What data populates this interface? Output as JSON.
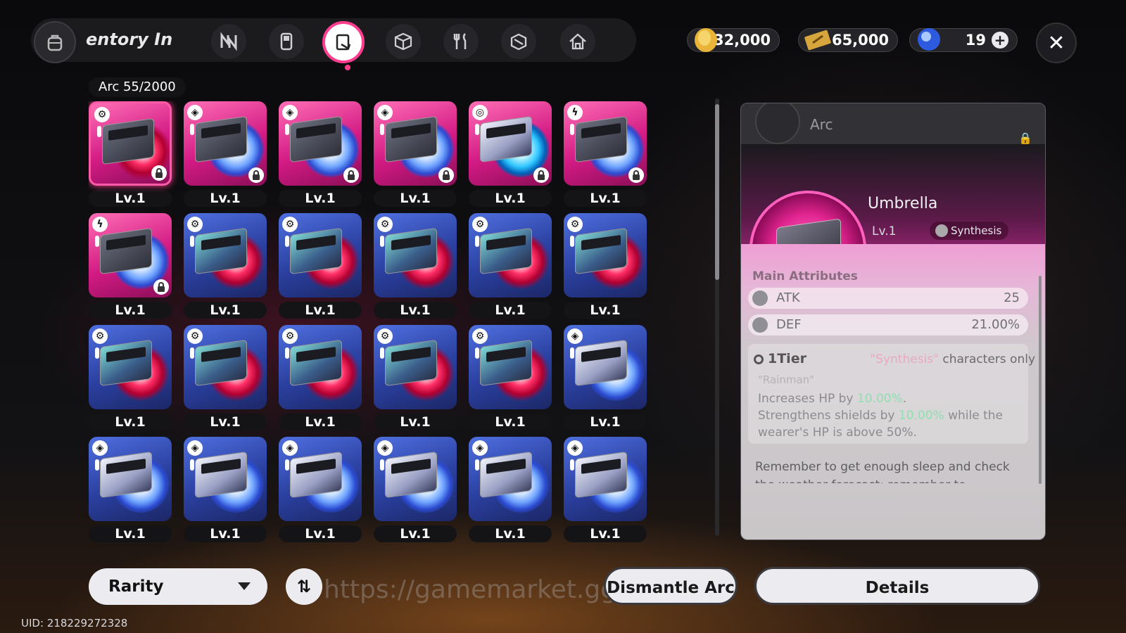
{
  "header": {
    "title": "entory  In",
    "categories": [
      "n-logo-icon",
      "console-icon",
      "arc-disc-icon",
      "cube-icon",
      "utensils-icon",
      "box-icon",
      "home-icon"
    ],
    "active_category": "arc-disc-icon",
    "accent": "#ff3d8e"
  },
  "currency": {
    "gold": "232,000",
    "tickets": "65,000",
    "gems": "19"
  },
  "inventory": {
    "label": "Arc",
    "count": "55/2000",
    "items": [
      {
        "level": "Lv.1",
        "rarity": "pink",
        "tag": "gear",
        "art": "red",
        "box": "dark",
        "locked": true,
        "selected": true
      },
      {
        "level": "Lv.1",
        "rarity": "pink",
        "tag": "cube",
        "art": "ice",
        "box": "dark",
        "locked": true
      },
      {
        "level": "Lv.1",
        "rarity": "pink",
        "tag": "cube",
        "art": "ice",
        "box": "dark",
        "locked": true
      },
      {
        "level": "Lv.1",
        "rarity": "pink",
        "tag": "cube",
        "art": "ice",
        "box": "dark",
        "locked": true
      },
      {
        "level": "Lv.1",
        "rarity": "pink",
        "tag": "swirl",
        "art": "cyan",
        "box": "white",
        "locked": true
      },
      {
        "level": "Lv.1",
        "rarity": "pink",
        "tag": "bolt",
        "art": "ice",
        "box": "dark",
        "locked": true
      },
      {
        "level": "Lv.1",
        "rarity": "pink",
        "tag": "bolt",
        "art": "ice",
        "box": "dark",
        "locked": true
      },
      {
        "level": "Lv.1",
        "rarity": "blue",
        "tag": "gear",
        "art": "red",
        "box": "hologram",
        "locked": false
      },
      {
        "level": "Lv.1",
        "rarity": "blue",
        "tag": "gear",
        "art": "red",
        "box": "hologram",
        "locked": false
      },
      {
        "level": "Lv.1",
        "rarity": "blue",
        "tag": "gear",
        "art": "red",
        "box": "hologram",
        "locked": false
      },
      {
        "level": "Lv.1",
        "rarity": "blue",
        "tag": "gear",
        "art": "red",
        "box": "hologram",
        "locked": false
      },
      {
        "level": "Lv.1",
        "rarity": "blue",
        "tag": "gear",
        "art": "red",
        "box": "hologram",
        "locked": false
      },
      {
        "level": "Lv.1",
        "rarity": "blue",
        "tag": "gear",
        "art": "red",
        "box": "hologram",
        "locked": false
      },
      {
        "level": "Lv.1",
        "rarity": "blue",
        "tag": "gear",
        "art": "red",
        "box": "hologram",
        "locked": false
      },
      {
        "level": "Lv.1",
        "rarity": "blue",
        "tag": "gear",
        "art": "red",
        "box": "hologram",
        "locked": false
      },
      {
        "level": "Lv.1",
        "rarity": "blue",
        "tag": "gear",
        "art": "red",
        "box": "hologram",
        "locked": false
      },
      {
        "level": "Lv.1",
        "rarity": "blue",
        "tag": "gear",
        "art": "red",
        "box": "hologram",
        "locked": false
      },
      {
        "level": "Lv.1",
        "rarity": "blue",
        "tag": "cube",
        "art": "ice",
        "box": "white",
        "locked": false
      },
      {
        "level": "Lv.1",
        "rarity": "blue",
        "tag": "cube",
        "art": "ice",
        "box": "white",
        "locked": false
      },
      {
        "level": "Lv.1",
        "rarity": "blue",
        "tag": "cube",
        "art": "ice",
        "box": "white",
        "locked": false
      },
      {
        "level": "Lv.1",
        "rarity": "blue",
        "tag": "cube",
        "art": "ice",
        "box": "white",
        "locked": false
      },
      {
        "level": "Lv.1",
        "rarity": "blue",
        "tag": "cube",
        "art": "ice",
        "box": "white",
        "locked": false
      },
      {
        "level": "Lv.1",
        "rarity": "blue",
        "tag": "cube",
        "art": "ice",
        "box": "white",
        "locked": false
      },
      {
        "level": "Lv.1",
        "rarity": "blue",
        "tag": "cube",
        "art": "ice",
        "box": "white",
        "locked": false
      }
    ]
  },
  "detail": {
    "category": "Arc",
    "name": "Umbrella",
    "level": "Lv.1",
    "type": "Synthesis",
    "stars": "★★★★★★",
    "main_attributes_label": "Main Attributes",
    "attributes": [
      {
        "name": "ATK",
        "value": "25"
      },
      {
        "name": "DEF",
        "value": "21.00%"
      }
    ],
    "tier": "1Tier",
    "tier_requirement_highlight": "\"Synthesis\"",
    "tier_requirement_rest": " characters only",
    "tier_quote": "\"Rainman\"",
    "desc_line1_pre": "Increases HP by ",
    "desc_line1_val": "10.00%",
    "desc_line1_post": ".",
    "desc_line2_pre": "Strengthens shields by ",
    "desc_line2_val": "10.00%",
    "desc_line2_post": " while the wearer's HP is above 50%.",
    "flavor": "Remember to get enough sleep and check the weather forecast; remember to"
  },
  "footer": {
    "rarity_label": "Rarity",
    "sort_label": "⇅",
    "dismantle_label": "Dismantle Arc",
    "details_label": "Details",
    "watermark": "https://gamemarket.gg/          gJohn",
    "uid": "UID: 218229272328"
  }
}
